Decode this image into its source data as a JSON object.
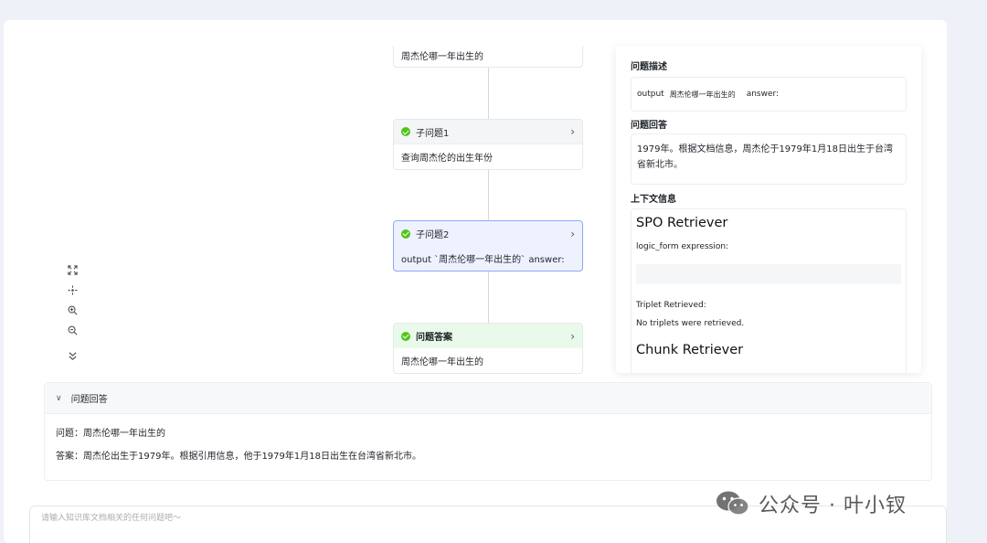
{
  "flow": {
    "nodes": [
      {
        "title": "",
        "body": "周杰伦哪一年出生的"
      },
      {
        "title": "子问题1",
        "body": "查询周杰伦的出生年份"
      },
      {
        "title": "子问题2",
        "body": "output `周杰伦哪一年出生的` answer:"
      },
      {
        "title": "问题答案",
        "body": "周杰伦哪一年出生的"
      }
    ]
  },
  "zoom_controls": [
    {
      "icon": "fit-view-icon"
    },
    {
      "icon": "center-icon"
    },
    {
      "icon": "zoom-in-icon"
    },
    {
      "icon": "zoom-out-icon"
    },
    {
      "icon": "collapse-icon"
    }
  ],
  "detail": {
    "desc_label": "问题描述",
    "desc_output": "output",
    "desc_question": "周杰伦哪一年出生的",
    "desc_answer": "answer:",
    "answer_label": "问题回答",
    "answer_text": "1979年。根据文档信息，周杰伦于1979年1月18日出生于台湾省新北市。",
    "context_label": "上下文信息",
    "spo_title": "SPO Retriever",
    "logic_form_label": "logic_form expression:",
    "triplet_label": "Triplet Retrieved:",
    "triplet_value": "No triplets were retrieved.",
    "chunk_title": "Chunk Retriever"
  },
  "result": {
    "header": "问题回答",
    "question_line": "问题：周杰伦哪一年出生的",
    "answer_line": "答案：周杰伦出生于1979年。根据引用信息，他于1979年1月18日出生在台湾省新北市。"
  },
  "input": {
    "placeholder": "请输入知识库文档相关的任何问题吧～"
  },
  "watermark": {
    "text": "公众号 · 叶小钗"
  },
  "colors": {
    "success": "#52c41a",
    "active_border": "#8fa8f5",
    "answer_bg": "#eafaea"
  }
}
